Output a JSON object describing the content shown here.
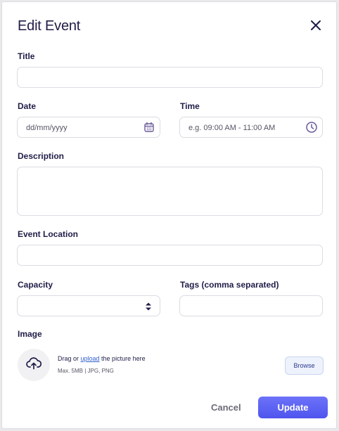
{
  "dialog": {
    "title": "Edit Event"
  },
  "fields": {
    "title_label": "Title",
    "title_value": "",
    "date_label": "Date",
    "date_placeholder": "dd/mm/yyyy",
    "time_label": "Time",
    "time_placeholder": "e.g. 09:00 AM - 11:00 AM",
    "description_label": "Description",
    "description_value": "",
    "location_label": "Event Location",
    "location_value": "",
    "capacity_label": "Capacity",
    "capacity_value": "",
    "tags_label": "Tags (comma separated)",
    "tags_value": ""
  },
  "image": {
    "label": "Image",
    "drag_prefix": "Drag or ",
    "upload_link": "upload",
    "drag_suffix": " the picture here",
    "hint": "Max. 5MB | JPG, PNG",
    "browse_label": "Browse"
  },
  "actions": {
    "cancel_label": "Cancel",
    "update_label": "Update"
  },
  "colors": {
    "primary": "#5a60f3",
    "heading": "#1f1d47",
    "icon_accent": "#6b5b9a"
  },
  "icons": [
    "close-icon",
    "calendar-icon",
    "clock-icon",
    "stepper-icon",
    "cloud-upload-icon"
  ]
}
